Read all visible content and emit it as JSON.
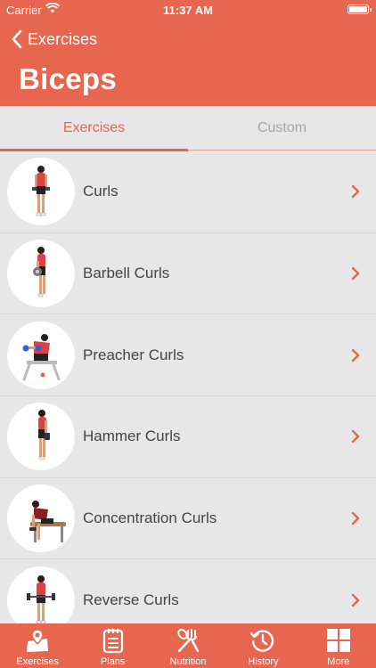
{
  "status": {
    "carrier": "Carrier",
    "time": "11:37 AM"
  },
  "nav": {
    "back_label": "Exercises",
    "title": "Biceps"
  },
  "segments": [
    {
      "label": "Exercises",
      "active": true
    },
    {
      "label": "Custom",
      "active": false
    }
  ],
  "exercises": [
    {
      "name": "Curls",
      "icon": "standing-curl-figure"
    },
    {
      "name": "Barbell Curls",
      "icon": "barbell-curl-figure"
    },
    {
      "name": "Preacher Curls",
      "icon": "preacher-curl-figure"
    },
    {
      "name": "Hammer Curls",
      "icon": "hammer-curl-figure"
    },
    {
      "name": "Concentration Curls",
      "icon": "concentration-curl-figure"
    },
    {
      "name": "Reverse Curls",
      "icon": "reverse-curl-figure"
    }
  ],
  "tabbar": [
    {
      "label": "Exercises",
      "icon": "dumbbell-map-icon"
    },
    {
      "label": "Plans",
      "icon": "notepad-icon"
    },
    {
      "label": "Nutrition",
      "icon": "fork-spoon-icon"
    },
    {
      "label": "History",
      "icon": "clock-history-icon"
    },
    {
      "label": "More",
      "icon": "grid-icon"
    }
  ],
  "colors": {
    "accent": "#e7664f",
    "background": "#e7e7e7",
    "row_text": "#444444",
    "inactive_tab": "#a6a6a6"
  }
}
